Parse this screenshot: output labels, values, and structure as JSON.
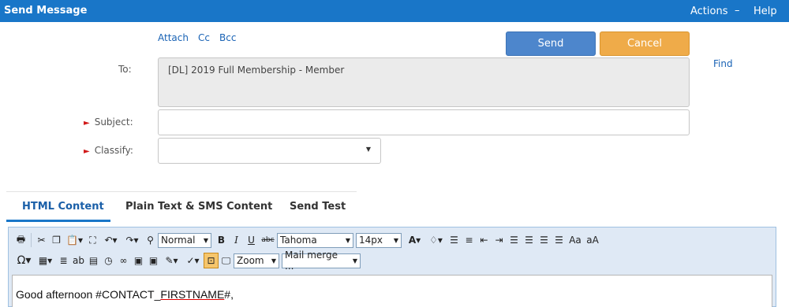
{
  "window": {
    "title": "Send Message",
    "actions_label": "Actions",
    "minimize_glyph": "–",
    "help_label": "Help"
  },
  "links": {
    "attach": "Attach",
    "cc": "Cc",
    "bcc": "Bcc",
    "find": "Find"
  },
  "buttons": {
    "send": "Send",
    "cancel": "Cancel"
  },
  "form": {
    "to_label": "To:",
    "to_value": "[DL] 2019 Full Membership - Member",
    "subject_label": "Subject:",
    "subject_value": "",
    "classify_label": "Classify:",
    "classify_value": "",
    "required_marker": "►"
  },
  "tabs": [
    {
      "label": "HTML Content",
      "active": true
    },
    {
      "label": "Plain Text & SMS Content",
      "active": false
    },
    {
      "label": "Send Test",
      "active": false
    }
  ],
  "toolbar": {
    "format_value": "Normal",
    "font_value": "Tahoma",
    "size_value": "14px",
    "zoom_value": "Zoom",
    "merge_value": "Mail merge ...",
    "bold": "B",
    "italic": "I",
    "underline": "U",
    "strike": "abc",
    "font_color": "A",
    "case_upper": "Aa",
    "case_lower": "aA",
    "special_char": "Ω"
  },
  "editor": {
    "greeting_text": "Good afternoon #CONTACT_",
    "token_text": "FIRSTNAME",
    "after_text": "#,"
  },
  "colors": {
    "titlebar": "#1976c8",
    "send": "#4d86cc",
    "cancel": "#efab49",
    "link": "#1a63b5",
    "required": "#d11a1a"
  }
}
